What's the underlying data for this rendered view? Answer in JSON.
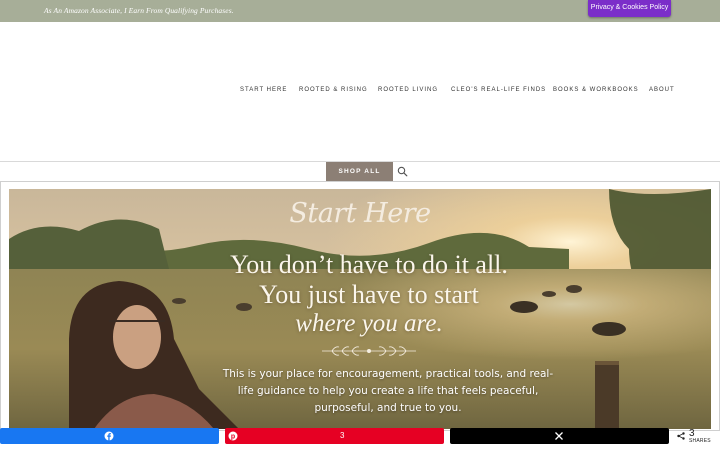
{
  "topbar": {
    "disclosure": "As An Amazon Associate, I Earn From Qualifying Purchases.",
    "privacy_button": "Privacy & Cookies Policy",
    "privacy_color": "#7b2ec9"
  },
  "nav": {
    "items": [
      "START HERE",
      "ROOTED & RISING",
      "ROOTED LIVING",
      "CLEO'S REAL-LIFE FINDS",
      "BOOKS & WORKBOOKS",
      "ABOUT"
    ]
  },
  "shop": {
    "label": "SHOP ALL",
    "search_icon": "search-icon"
  },
  "hero": {
    "script_title": "Start Here",
    "line1": "You don’t have to do it all.",
    "line2": "You just have to start",
    "line3": "where you are.",
    "body": "This is your place for encouragement, practical tools, and real-life guidance to help you create a life that feels peaceful, purposeful, and true to you."
  },
  "share_bar": {
    "facebook_icon": "facebook-icon",
    "pinterest_icon": "pinterest-icon",
    "pinterest_count": "3",
    "x_icon": "x-icon",
    "total": "3",
    "label": "SHARES",
    "colors": {
      "facebook": "#1877f2",
      "pinterest": "#e60023",
      "x": "#000000"
    }
  }
}
